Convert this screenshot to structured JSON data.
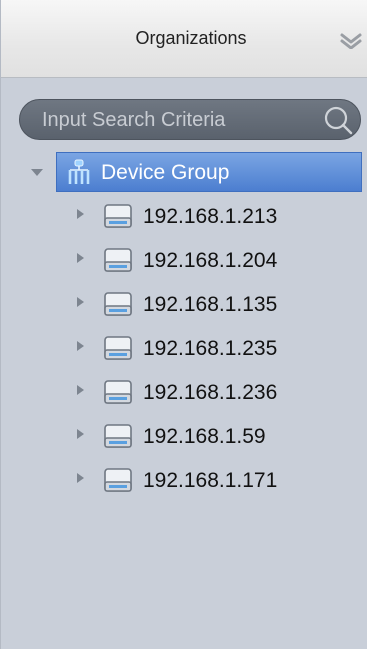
{
  "header": {
    "title": "Organizations",
    "collapse_icon": "double-chevron-down-icon"
  },
  "search": {
    "placeholder": "Input Search Criteria",
    "value": "",
    "icon": "search-icon"
  },
  "tree": {
    "root": {
      "label": "Device Group",
      "expanded": true,
      "selected": true,
      "icon": "device-group-icon"
    },
    "nodes": [
      {
        "label": "192.168.1.213",
        "icon": "device-icon"
      },
      {
        "label": "192.168.1.204",
        "icon": "device-icon"
      },
      {
        "label": "192.168.1.135",
        "icon": "device-icon"
      },
      {
        "label": "192.168.1.235",
        "icon": "device-icon"
      },
      {
        "label": "192.168.1.236",
        "icon": "device-icon"
      },
      {
        "label": "192.168.1.59",
        "icon": "device-icon"
      },
      {
        "label": "192.168.1.171",
        "icon": "device-icon"
      }
    ]
  },
  "colors": {
    "panel_bg": "#c9cfd9",
    "selection": "#5b8bd8",
    "search_bg": "#646c77"
  }
}
